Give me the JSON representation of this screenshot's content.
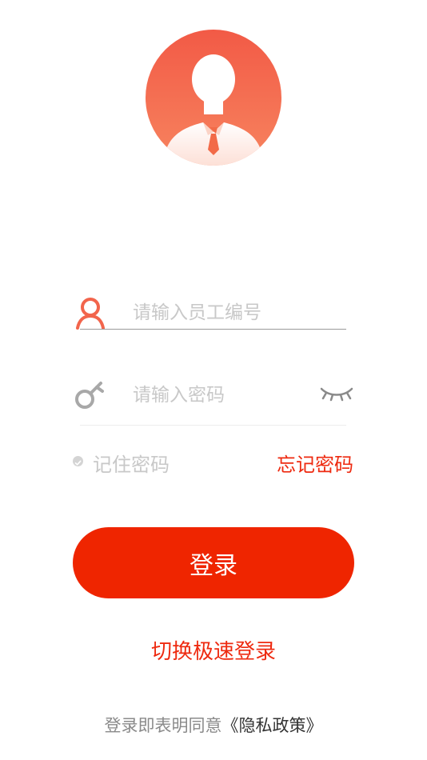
{
  "avatar": {
    "icon": "user-silhouette-icon"
  },
  "employee_id": {
    "icon": "user-icon",
    "value": "",
    "placeholder": "请输入员工编号"
  },
  "password": {
    "icon": "key-icon",
    "value": "",
    "placeholder": "请输入密码",
    "visibility_icon": "eye-closed-icon"
  },
  "remember": {
    "label": "记住密码",
    "checked": false
  },
  "forgot_label": "忘记密码",
  "login_label": "登录",
  "switch_label": "切换极速登录",
  "agreement": {
    "prefix": "登录即表明同意",
    "policy": "《隐私政策》"
  },
  "colors": {
    "brand": "#ef2500",
    "link": "#ee2a10",
    "avatar_top": "#f25a46",
    "avatar_bottom": "#f7845f",
    "placeholder": "#c8c8c8"
  }
}
